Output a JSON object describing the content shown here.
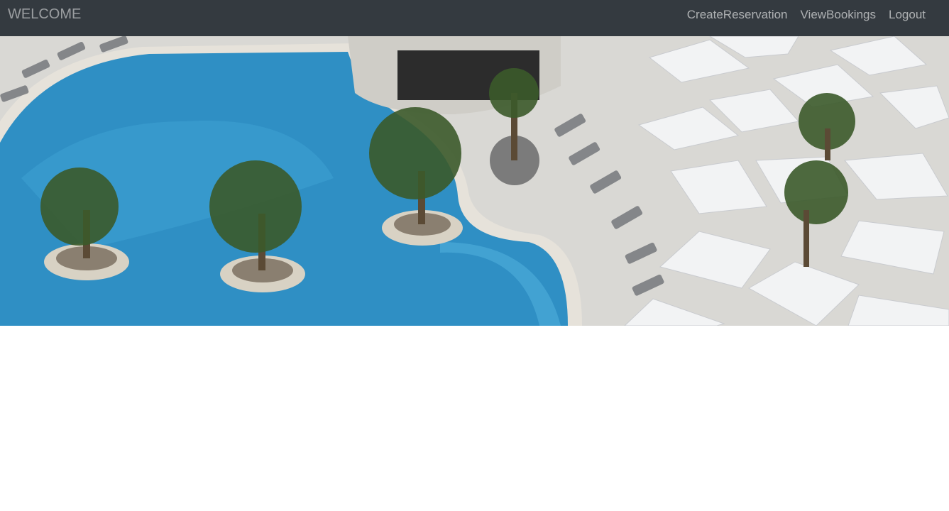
{
  "navbar": {
    "brand": "WELCOME",
    "links": [
      {
        "label": "CreateReservation"
      },
      {
        "label": "ViewBookings"
      },
      {
        "label": "Logout"
      }
    ],
    "background": "#343a40"
  },
  "hero": {
    "image": "pool-resort-aerial-photo",
    "colors": {
      "water": "#2f8fc4",
      "deck": "#dcdcda",
      "umbrella": "#f2f3f4",
      "palm": "#3b5a2a"
    }
  }
}
